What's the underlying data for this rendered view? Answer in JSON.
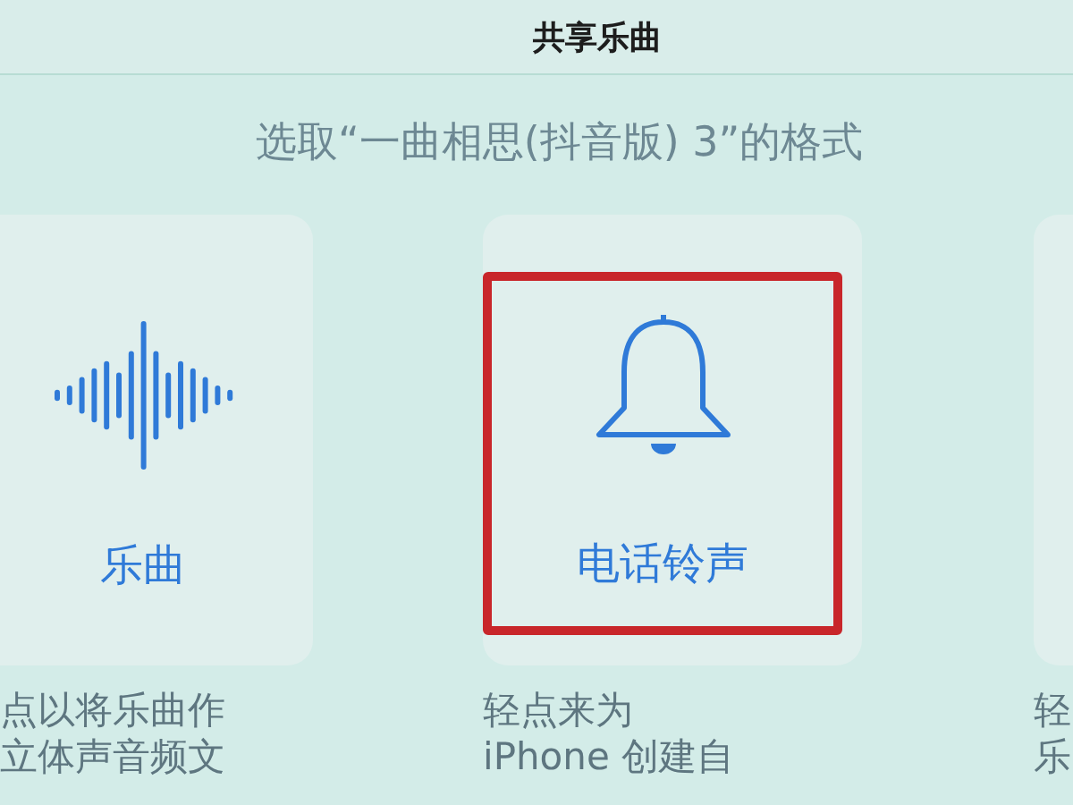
{
  "header": {
    "title": "共享乐曲"
  },
  "prompt": "选取“一曲相思(抖音版) 3”的格式",
  "options": [
    {
      "kind": "song",
      "label": "乐曲",
      "highlighted": false,
      "description": [
        "点以将乐曲作",
        "立体声音频文"
      ]
    },
    {
      "kind": "ringtone",
      "label": "电话铃声",
      "highlighted": true,
      "description": [
        "轻点来为",
        "iPhone 创建自"
      ]
    },
    {
      "kind": "other",
      "highlighted": false,
      "description": [
        "轻",
        "乐"
      ]
    }
  ]
}
